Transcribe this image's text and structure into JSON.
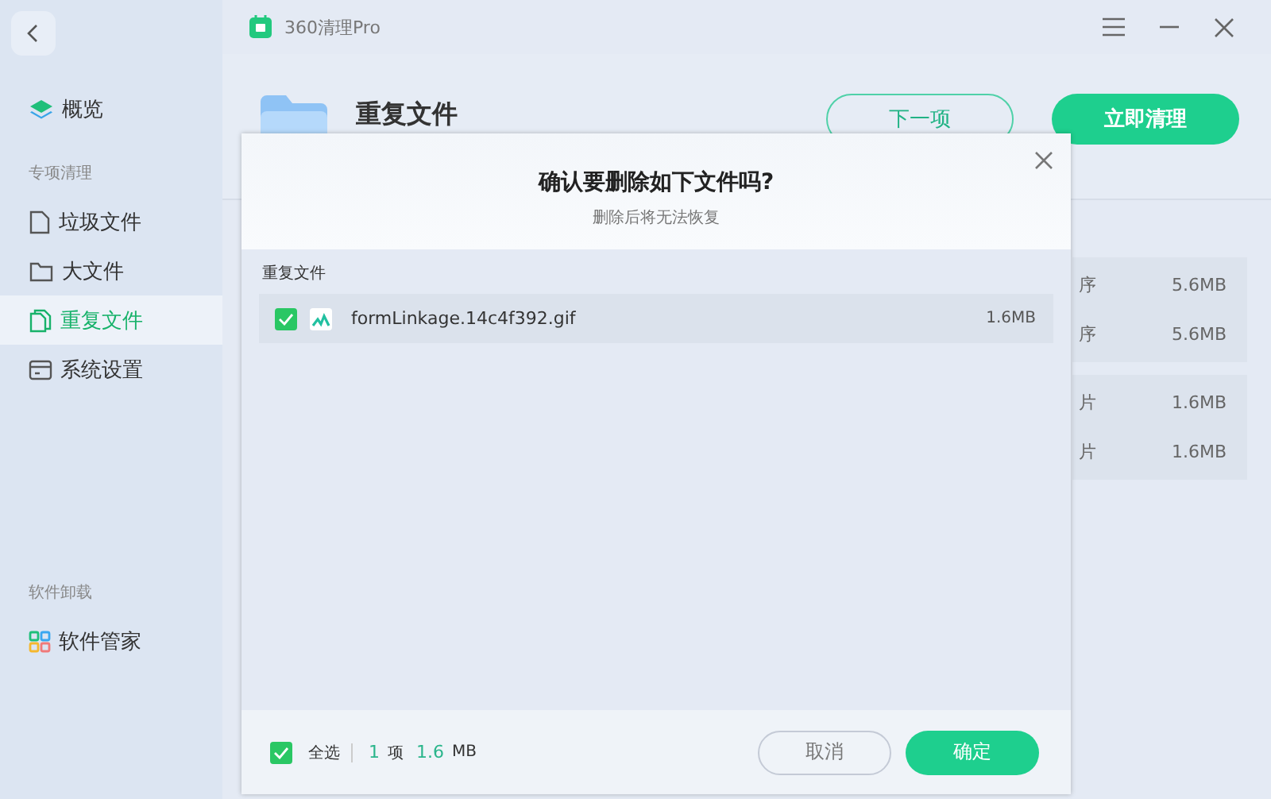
{
  "app": {
    "title": "360清理Pro"
  },
  "sidebar": {
    "groups": [
      {
        "items": [
          {
            "label": "概览",
            "selected": false
          }
        ]
      },
      {
        "heading": "专项清理",
        "items": [
          {
            "label": "垃圾文件",
            "selected": false
          },
          {
            "label": "大文件",
            "selected": false
          },
          {
            "label": "重复文件",
            "selected": true
          },
          {
            "label": "系统设置",
            "selected": false
          }
        ]
      },
      {
        "heading": "软件卸载",
        "items": [
          {
            "label": "软件管家",
            "selected": false
          }
        ]
      }
    ]
  },
  "header": {
    "title": "重复文件",
    "buttons": [
      {
        "label": "下一项",
        "kind": "outline"
      },
      {
        "label": "立即清理",
        "kind": "primary"
      }
    ]
  },
  "background_groups": [
    [
      {
        "label": "序",
        "size": "5.6MB"
      },
      {
        "label": "序",
        "size": "5.6MB"
      }
    ],
    [
      {
        "label": "片",
        "size": "1.6MB"
      },
      {
        "label": "片",
        "size": "1.6MB"
      }
    ]
  ],
  "dialog": {
    "title": "确认要删除如下文件吗?",
    "subtitle": "删除后将无法恢复",
    "section": "重复文件",
    "files": [
      {
        "name": "formLinkage.14c4f392.gif",
        "size": "1.6MB",
        "checked": true
      }
    ],
    "select_all": {
      "label": "全选",
      "checked": true
    },
    "count": "1",
    "count_unit": "项",
    "total": "1.6",
    "total_unit": "MB",
    "buttons": [
      {
        "label": "取消",
        "kind": "secondary"
      },
      {
        "label": "确定",
        "kind": "primary"
      }
    ]
  }
}
